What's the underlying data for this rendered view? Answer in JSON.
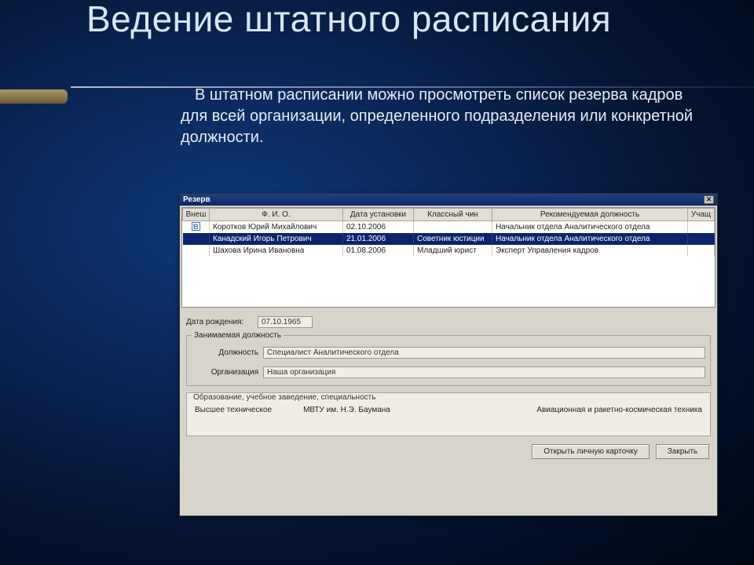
{
  "slide": {
    "title": "Ведение штатного расписания",
    "body": "В штатном расписании можно просмотреть список резерва кадров для всей организации, определенного подразделения или конкретной должности."
  },
  "window": {
    "title": "Резерв",
    "close_glyph": "✕"
  },
  "grid": {
    "headers": {
      "vnesh": "Внеш",
      "fio": "Ф. И. О.",
      "date": "Дата установки",
      "rank": "Классный чин",
      "rec": "Рекомендуемая должность",
      "stud": "Учащ"
    },
    "rows": [
      {
        "icon": "В",
        "fio": "Коротков Юрий Михайлович",
        "date": "02.10.2006",
        "rank": "",
        "rec": "Начальник отдела Аналитического отдела",
        "stud": ""
      },
      {
        "icon": "",
        "fio": "Канадский Игорь Петрович",
        "date": "21.01.2006",
        "rank": "Советник юстиции",
        "rec": "Начальник отдела Аналитического отдела",
        "stud": ""
      },
      {
        "icon": "",
        "fio": "Шахова Ирина Ивановна",
        "date": "01.08.2006",
        "rank": "Младший юрист",
        "rec": "Эксперт Управления кадров",
        "stud": ""
      }
    ]
  },
  "details": {
    "birth_label": "Дата рождения:",
    "birth_value": "07.10.1965",
    "group_title": "Занимаемая должность",
    "position_label": "Должность",
    "position_value": "Специалист Аналитического отдела",
    "org_label": "Организация",
    "org_value": "Наша организация"
  },
  "education": {
    "header_line": "Образование, учебное заведение, специальность",
    "level": "Высшее техническое",
    "school": "МВТУ им. Н.Э. Баумана",
    "spec": "Авиационная и ракетно-космическая техника"
  },
  "buttons": {
    "open_card": "Открыть личную карточку",
    "close": "Закрыть"
  }
}
